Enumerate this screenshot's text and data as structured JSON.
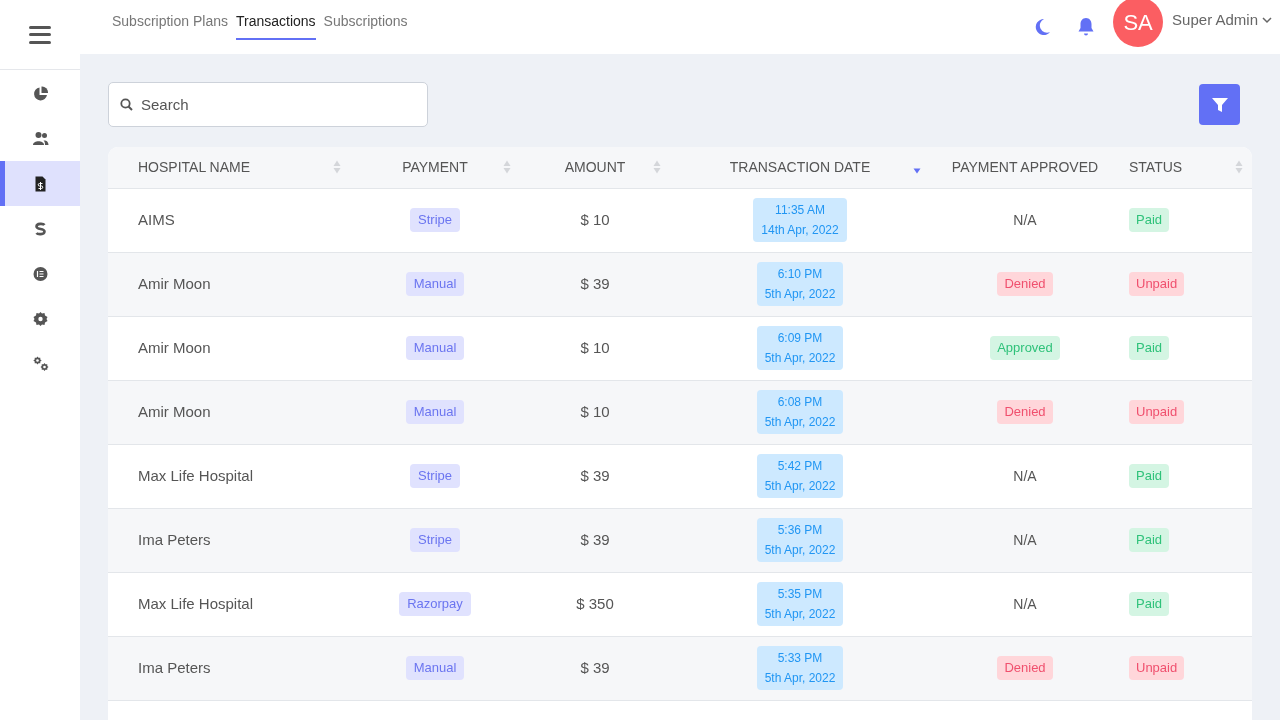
{
  "top_tabs": [
    {
      "label": "Subscription Plans",
      "selected": false
    },
    {
      "label": "Transactions",
      "selected": true
    },
    {
      "label": "Subscriptions",
      "selected": false
    }
  ],
  "user": {
    "initials": "SA",
    "name": "Super Admin"
  },
  "sidebar": {
    "items": [
      {
        "selected": false
      },
      {
        "selected": false
      },
      {
        "selected": true
      },
      {
        "selected": false
      },
      {
        "selected": false
      },
      {
        "selected": false
      },
      {
        "selected": false
      }
    ]
  },
  "search": {
    "placeholder": "Search"
  },
  "table": {
    "columns": [
      {
        "label": "HOSPITAL NAME",
        "kind": "sortable"
      },
      {
        "label": "PAYMENT",
        "kind": "sortable"
      },
      {
        "label": "AMOUNT",
        "kind": "sortable"
      },
      {
        "label": "TRANSACTION DATE",
        "kind": "sorted"
      },
      {
        "label": "PAYMENT APPROVED",
        "kind": "plain"
      },
      {
        "label": "STATUS",
        "kind": "sortable"
      }
    ],
    "rows": [
      {
        "hospital": "AIMS",
        "payment": "Stripe",
        "amount": "$ 10",
        "time": "11:35 AM",
        "date": "14th Apr, 2022",
        "approved": {
          "text": "N/A",
          "kind": "plain"
        },
        "status": {
          "text": "Paid",
          "kind": "success"
        }
      },
      {
        "hospital": "Amir Moon",
        "payment": "Manual",
        "amount": "$ 39",
        "time": "6:10 PM",
        "date": "5th Apr, 2022",
        "approved": {
          "text": "Denied",
          "kind": "danger"
        },
        "status": {
          "text": "Unpaid",
          "kind": "danger"
        }
      },
      {
        "hospital": "Amir Moon",
        "payment": "Manual",
        "amount": "$ 10",
        "time": "6:09 PM",
        "date": "5th Apr, 2022",
        "approved": {
          "text": "Approved",
          "kind": "success"
        },
        "status": {
          "text": "Paid",
          "kind": "success"
        }
      },
      {
        "hospital": "Amir Moon",
        "payment": "Manual",
        "amount": "$ 10",
        "time": "6:08 PM",
        "date": "5th Apr, 2022",
        "approved": {
          "text": "Denied",
          "kind": "danger"
        },
        "status": {
          "text": "Unpaid",
          "kind": "danger"
        }
      },
      {
        "hospital": "Max Life Hospital",
        "payment": "Stripe",
        "amount": "$ 39",
        "time": "5:42 PM",
        "date": "5th Apr, 2022",
        "approved": {
          "text": "N/A",
          "kind": "plain"
        },
        "status": {
          "text": "Paid",
          "kind": "success"
        }
      },
      {
        "hospital": "Ima Peters",
        "payment": "Stripe",
        "amount": "$ 39",
        "time": "5:36 PM",
        "date": "5th Apr, 2022",
        "approved": {
          "text": "N/A",
          "kind": "plain"
        },
        "status": {
          "text": "Paid",
          "kind": "success"
        }
      },
      {
        "hospital": "Max Life Hospital",
        "payment": "Razorpay",
        "amount": "$ 350",
        "time": "5:35 PM",
        "date": "5th Apr, 2022",
        "approved": {
          "text": "N/A",
          "kind": "plain"
        },
        "status": {
          "text": "Paid",
          "kind": "success"
        }
      },
      {
        "hospital": "Ima Peters",
        "payment": "Manual",
        "amount": "$ 39",
        "time": "5:33 PM",
        "date": "5th Apr, 2022",
        "approved": {
          "text": "Denied",
          "kind": "danger"
        },
        "status": {
          "text": "Unpaid",
          "kind": "danger"
        }
      }
    ]
  }
}
